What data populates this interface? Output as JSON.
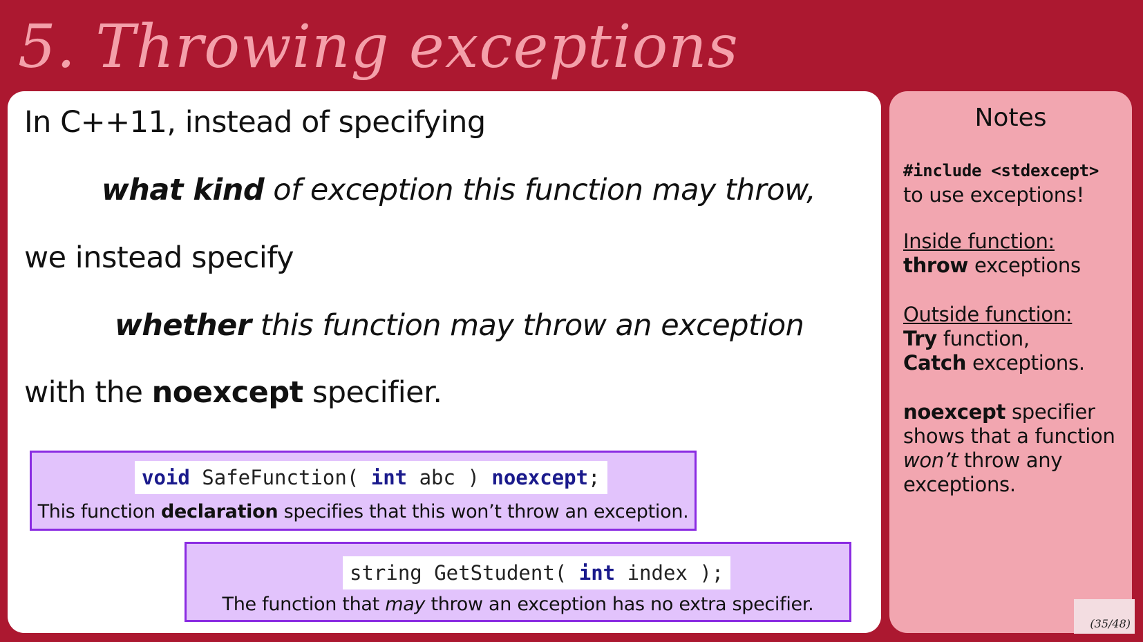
{
  "slide": {
    "title": "5. Throwing exceptions",
    "page_indicator": "(35/48)"
  },
  "main": {
    "line1": "In C++11, instead of specifying",
    "line2_bold": "what kind",
    "line2_rest": " of exception this function may throw,",
    "line3": "we instead specify",
    "line4_bold": "whether",
    "line4_rest": " this function may throw an exception",
    "line5_pre": "with the ",
    "line5_bold": "noexcept",
    "line5_post": " specifier."
  },
  "code_boxes": [
    {
      "code_kw1": "void",
      "code_mid1": " SafeFunction( ",
      "code_kw2": "int",
      "code_mid2": " abc ) ",
      "code_kw3": "noexcept",
      "code_end": ";",
      "caption_pre": "This function ",
      "caption_bold": "declaration",
      "caption_post": " specifies that this won’t throw an exception."
    },
    {
      "code_pre": "string GetStudent( ",
      "code_kw": "int",
      "code_post": " index );",
      "caption_pre": "The function that ",
      "caption_italic": "may",
      "caption_post": "  throw an exception has no extra specifier."
    }
  ],
  "notes": {
    "title": "Notes",
    "include_code": "#include <stdexcept>",
    "include_text": "to use exceptions!",
    "inside_heading": "Inside function:",
    "inside_bold": "throw",
    "inside_rest": " exceptions",
    "outside_heading": "Outside function:",
    "try_bold": "Try",
    "try_rest": " function,",
    "catch_bold": "Catch",
    "catch_rest": " exceptions.",
    "noexcept_bold": "noexcept",
    "noexcept_rest": " specifier",
    "noexcept_line2": "shows that a function",
    "noexcept_italic": "won’t",
    "noexcept_line3_rest": " throw any",
    "noexcept_line4": "exceptions."
  }
}
